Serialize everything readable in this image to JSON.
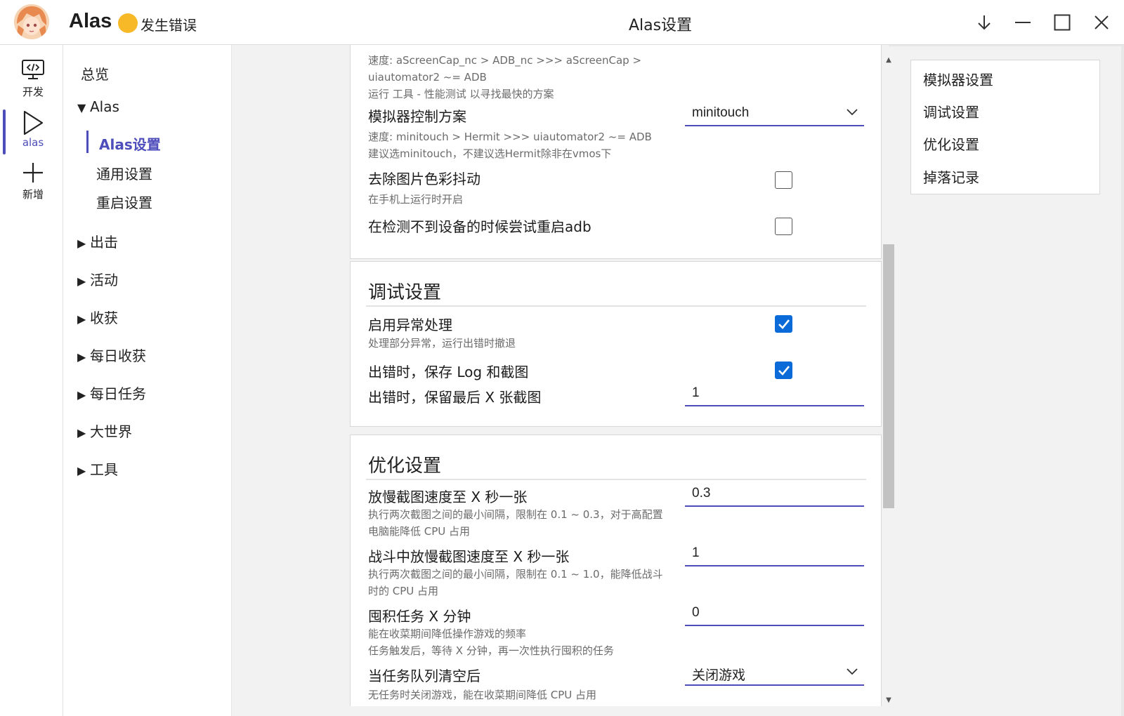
{
  "titlebar": {
    "app_name": "Alas",
    "status": "发生错误",
    "status_color": "#f7b928",
    "window_title": "Alas设置",
    "buttons": [
      "download-arrow-icon",
      "minimize-icon",
      "maximize-icon",
      "close-icon"
    ]
  },
  "iconbar": {
    "items": [
      {
        "label": "开发",
        "icon": "code-monitor-icon"
      },
      {
        "label": "alas",
        "icon": "play-icon",
        "active": true
      },
      {
        "label": "新增",
        "icon": "plus-icon"
      }
    ],
    "accent": "#4d4dbb"
  },
  "nav": {
    "overview": "总览",
    "alas": "Alas",
    "alas_children": [
      "Alas设置",
      "通用设置",
      "重启设置"
    ],
    "groups": [
      "出击",
      "活动",
      "收获",
      "每日收获",
      "每日任务",
      "大世界",
      "工具"
    ]
  },
  "emulator": {
    "screenshot_help_1": "速度: aScreenCap_nc > ADB_nc >>> aScreenCap >",
    "screenshot_help_2": "uiautomator2 ~= ADB",
    "screenshot_help_3": "运行 工具 - 性能测试 以寻找最快的方案",
    "control_label": "模拟器控制方案",
    "control_value": "minitouch",
    "control_help_1": "速度: minitouch > Hermit >>> uiautomator2 ~= ADB",
    "control_help_2": "建议选minitouch，不建议选Hermit除非在vmos下",
    "dither_label": "去除图片色彩抖动",
    "dither_help": "在手机上运行时开启",
    "dither_checked": false,
    "restart_adb_label": "在检测不到设备的时候尝试重启adb",
    "restart_adb_checked": false
  },
  "debug": {
    "title": "调试设置",
    "exception_label": "启用异常处理",
    "exception_help": "处理部分异常，运行出错时撤退",
    "exception_checked": true,
    "save_log_label": "出错时，保存 Log 和截图",
    "save_log_checked": true,
    "keep_label": "出错时，保留最后 X 张截图",
    "keep_value": "1"
  },
  "optimization": {
    "title": "优化设置",
    "interval_label": "放慢截图速度至 X 秒一张",
    "interval_value": "0.3",
    "interval_help_1": "执行两次截图之间的最小间隔，限制在 0.1 ~ 0.3，对于高配置",
    "interval_help_2": "电脑能降低 CPU 占用",
    "combat_label": "战斗中放慢截图速度至 X 秒一张",
    "combat_value": "1",
    "combat_help_1": "执行两次截图之间的最小间隔，限制在 0.1 ~ 1.0，能降低战斗",
    "combat_help_2": "时的 CPU 占用",
    "hoard_label": "囤积任务 X 分钟",
    "hoard_value": "0",
    "hoard_help_1": "能在收菜期间降低操作游戏的频率",
    "hoard_help_2": "任务触发后，等待 X 分钟，再一次性执行囤积的任务",
    "queue_label": "当任务队列清空后",
    "queue_value": "关闭游戏",
    "queue_help": "无任务时关闭游戏，能在收菜期间降低 CPU 占用"
  },
  "toc": {
    "items": [
      "模拟器设置",
      "调试设置",
      "优化设置",
      "掉落记录"
    ]
  },
  "colors": {
    "accent": "#4d4dbb",
    "checkbox_checked": "#0a6ad8"
  }
}
